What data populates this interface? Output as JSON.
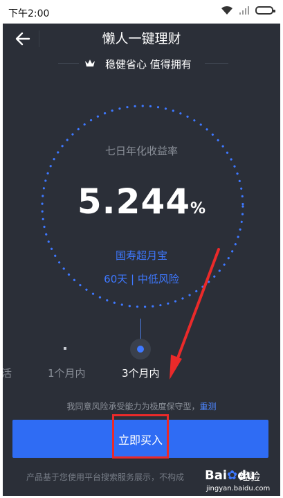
{
  "status_bar": {
    "time": "下午2:00"
  },
  "header": {
    "title": "懒人一键理财"
  },
  "slogan": {
    "text": "稳健省心 值得拥有"
  },
  "rate": {
    "label": "七日年化收益率",
    "value": "5.244",
    "unit": "%"
  },
  "product": {
    "name": "国寿超月宝",
    "meta": "60天 | 中低风险"
  },
  "options": [
    {
      "label": "活",
      "selected": false
    },
    {
      "label": "1个月内",
      "selected": false
    },
    {
      "label": "3个月内",
      "selected": true
    }
  ],
  "agreement": {
    "text": "我同意风险承受能力为极度保守型，",
    "link": "重测"
  },
  "buy_button": {
    "label": "立即买入"
  },
  "footer": {
    "note": "产品基于您使用平台搜索服务展示，不构成"
  },
  "watermark": {
    "brand_a": "Bai",
    "brand_b": "du",
    "brand_c": "经验",
    "url": "jingyan.baidu.com"
  },
  "colors": {
    "background": "#2b2f38",
    "accent": "#3e78ff",
    "button": "#2f6cf4",
    "annotation": "#ea2a2a"
  }
}
